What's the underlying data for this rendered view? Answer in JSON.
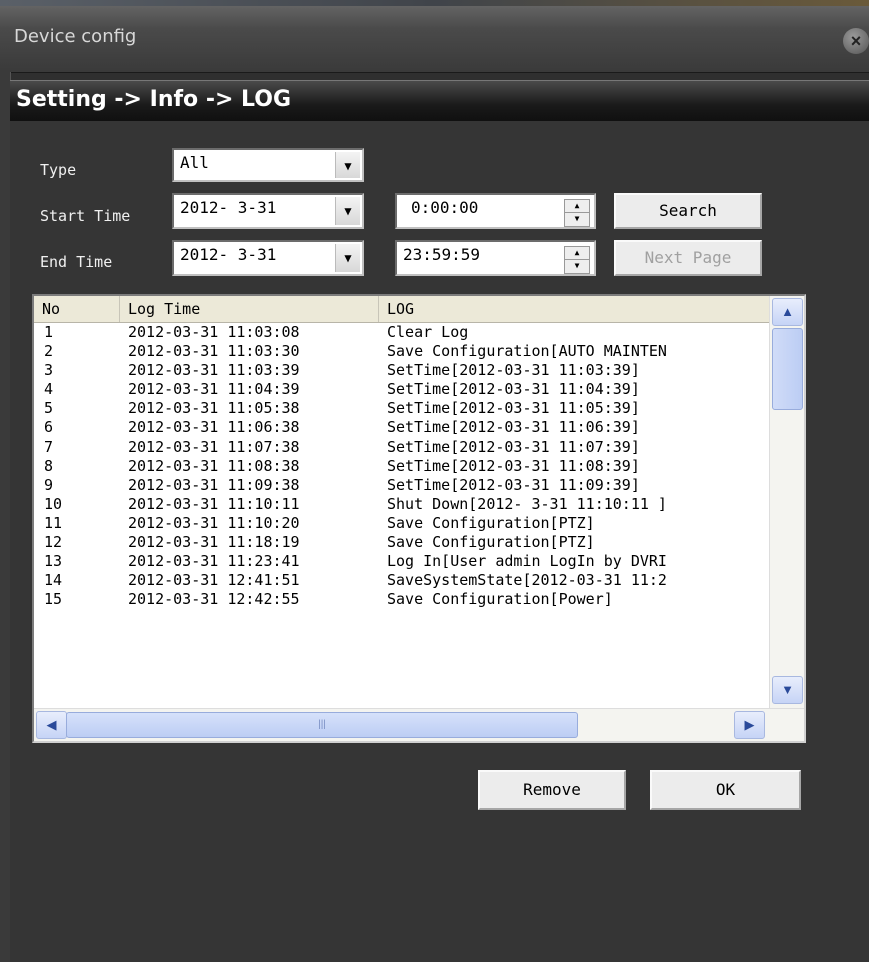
{
  "window": {
    "title": "Device config",
    "close_label": "×"
  },
  "breadcrumb": "Setting -> Info -> LOG",
  "form": {
    "type_label": "Type",
    "type_value": "All",
    "start_label": "Start Time",
    "start_date": "2012- 3-31",
    "start_time": "0:00:00",
    "end_label": "End Time",
    "end_date": "2012- 3-31",
    "end_time": "23:59:59",
    "search_label": "Search",
    "next_page_label": "Next Page"
  },
  "log_table": {
    "columns": [
      "No",
      "Log Time",
      "LOG"
    ],
    "rows": [
      {
        "no": "1",
        "time": "2012-03-31 11:03:08",
        "log": "Clear Log"
      },
      {
        "no": "2",
        "time": "2012-03-31 11:03:30",
        "log": "Save Configuration[AUTO MAINTEN"
      },
      {
        "no": "3",
        "time": "2012-03-31 11:03:39",
        "log": "SetTime[2012-03-31 11:03:39]"
      },
      {
        "no": "4",
        "time": "2012-03-31 11:04:39",
        "log": "SetTime[2012-03-31 11:04:39]"
      },
      {
        "no": "5",
        "time": "2012-03-31 11:05:38",
        "log": "SetTime[2012-03-31 11:05:39]"
      },
      {
        "no": "6",
        "time": "2012-03-31 11:06:38",
        "log": "SetTime[2012-03-31 11:06:39]"
      },
      {
        "no": "7",
        "time": "2012-03-31 11:07:38",
        "log": "SetTime[2012-03-31 11:07:39]"
      },
      {
        "no": "8",
        "time": "2012-03-31 11:08:38",
        "log": "SetTime[2012-03-31 11:08:39]"
      },
      {
        "no": "9",
        "time": "2012-03-31 11:09:38",
        "log": "SetTime[2012-03-31 11:09:39]"
      },
      {
        "no": "10",
        "time": "2012-03-31 11:10:11",
        "log": "Shut Down[2012- 3-31 11:10:11 ]"
      },
      {
        "no": "11",
        "time": "2012-03-31 11:10:20",
        "log": "Save Configuration[PTZ]"
      },
      {
        "no": "12",
        "time": "2012-03-31 11:18:19",
        "log": "Save Configuration[PTZ]"
      },
      {
        "no": "13",
        "time": "2012-03-31 11:23:41",
        "log": "Log In[User admin LogIn by DVRI"
      },
      {
        "no": "14",
        "time": "2012-03-31 12:41:51",
        "log": "SaveSystemState[2012-03-31 11:2"
      },
      {
        "no": "15",
        "time": "2012-03-31 12:42:55",
        "log": "Save Configuration[Power]"
      }
    ]
  },
  "actions": {
    "remove_label": "Remove",
    "ok_label": "OK"
  }
}
